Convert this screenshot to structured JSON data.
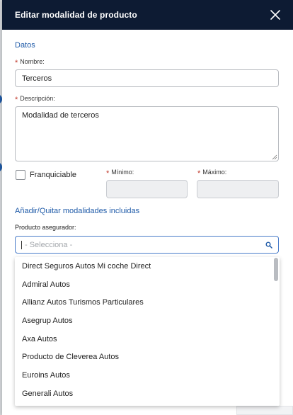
{
  "modal": {
    "title": "Editar modalidad de producto",
    "close_icon": "close-icon"
  },
  "datos": {
    "section_title": "Datos",
    "nombre": {
      "label": "Nombre:",
      "value": "Terceros",
      "required": true
    },
    "descripcion": {
      "label": "Descripción:",
      "value": "Modalidad de terceros",
      "required": true
    },
    "franquiciable": {
      "label": "Franquiciable",
      "checked": false
    },
    "minimo": {
      "label": "Mínimo:",
      "value": "",
      "required": true
    },
    "maximo": {
      "label": "Máximo:",
      "value": "",
      "required": true
    }
  },
  "modalidades": {
    "section_title": "Añadir/Quitar modalidades incluidas",
    "producto_label": "Producto asegurador:",
    "placeholder": "- Selecciona -",
    "options": [
      "Direct Seguros Autos Mi coche Direct",
      "Admiral Autos",
      "Allianz Autos Turismos Particulares",
      "Asegrup Autos",
      "Axa Autos",
      "Producto de Cleverea Autos",
      "Euroins Autos",
      "Generali Autos"
    ]
  },
  "colors": {
    "header_bg": "#0d1b33",
    "accent": "#1e5aa8",
    "required": "#c0392b"
  }
}
